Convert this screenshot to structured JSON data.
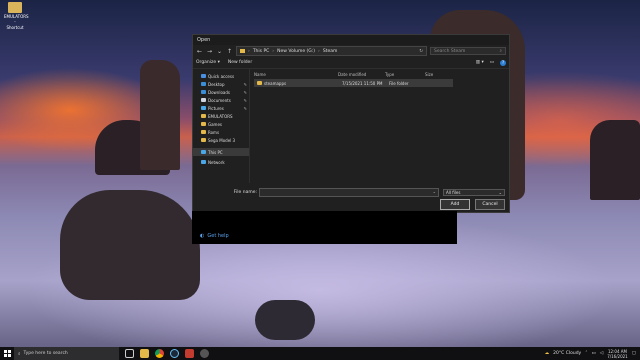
{
  "desktop": {
    "icon_label_line1": "EMULATORS -",
    "icon_label_line2": "Shortcut"
  },
  "dialog": {
    "title": "Open",
    "path": [
      "This PC",
      "New Volume (G:)",
      "Steam"
    ],
    "search_placeholder": "Search Steam",
    "toolbar": {
      "organize": "Organize ▾",
      "new_folder": "New folder"
    },
    "nav_items": [
      {
        "label": "Quick access",
        "icon": "star-icon",
        "color": "#4a90e2",
        "pinned": false
      },
      {
        "label": "Desktop",
        "icon": "desktop-icon",
        "color": "#3b8fd9",
        "pinned": true
      },
      {
        "label": "Downloads",
        "icon": "download-icon",
        "color": "#3b8fd9",
        "pinned": true
      },
      {
        "label": "Documents",
        "icon": "documents-icon",
        "color": "#cfd6e0",
        "pinned": true
      },
      {
        "label": "Pictures",
        "icon": "pictures-icon",
        "color": "#4aa7e8",
        "pinned": true
      },
      {
        "label": "EMULATORS",
        "icon": "folder-icon",
        "color": "#e3b94a",
        "pinned": false
      },
      {
        "label": "Games",
        "icon": "folder-icon",
        "color": "#e3b94a",
        "pinned": false
      },
      {
        "label": "Roms",
        "icon": "folder-icon",
        "color": "#e3b94a",
        "pinned": false
      },
      {
        "label": "Sega Model 3",
        "icon": "folder-icon",
        "color": "#e3b94a",
        "pinned": false
      },
      {
        "label": "This PC",
        "icon": "computer-icon",
        "color": "#4aa7e8",
        "pinned": false,
        "selected": true
      },
      {
        "label": "Network",
        "icon": "network-icon",
        "color": "#4aa7e8",
        "pinned": false
      }
    ],
    "columns": [
      "Name",
      "Date modified",
      "Type",
      "Size"
    ],
    "files": [
      {
        "name": "steamapps",
        "date": "7/15/2021 11:50 PM",
        "type": "File folder",
        "size": ""
      }
    ],
    "file_name_label": "File name:",
    "file_name_value": "",
    "filter": "All files",
    "open_button": "Add",
    "cancel_button": "Cancel",
    "get_help": "Get help"
  },
  "taskbar": {
    "search_placeholder": "Type here to search",
    "weather": "20°C  Cloudy",
    "time": "12:04 AM",
    "date": "7/16/2021"
  }
}
